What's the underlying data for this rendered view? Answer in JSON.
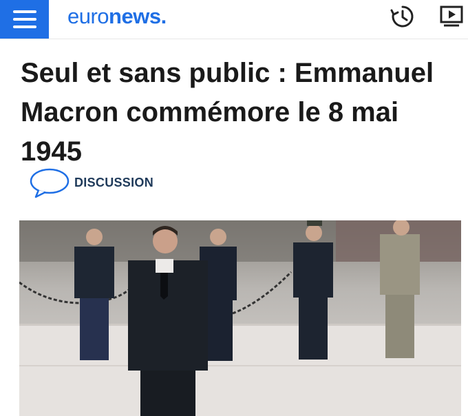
{
  "header": {
    "logo_light": "euro",
    "logo_bold": "news",
    "logo_dot": "."
  },
  "article": {
    "headline": "Seul et sans public : Emmanuel Macron commémore le 8 mai 1945",
    "discussion_label": "DISCUSSION"
  },
  "colors": {
    "brand_blue": "#1f6fe5",
    "discussion_text": "#1f3a5a"
  },
  "icons": [
    "menu-icon",
    "history-icon",
    "video-play-icon",
    "speech-bubble-icon"
  ]
}
